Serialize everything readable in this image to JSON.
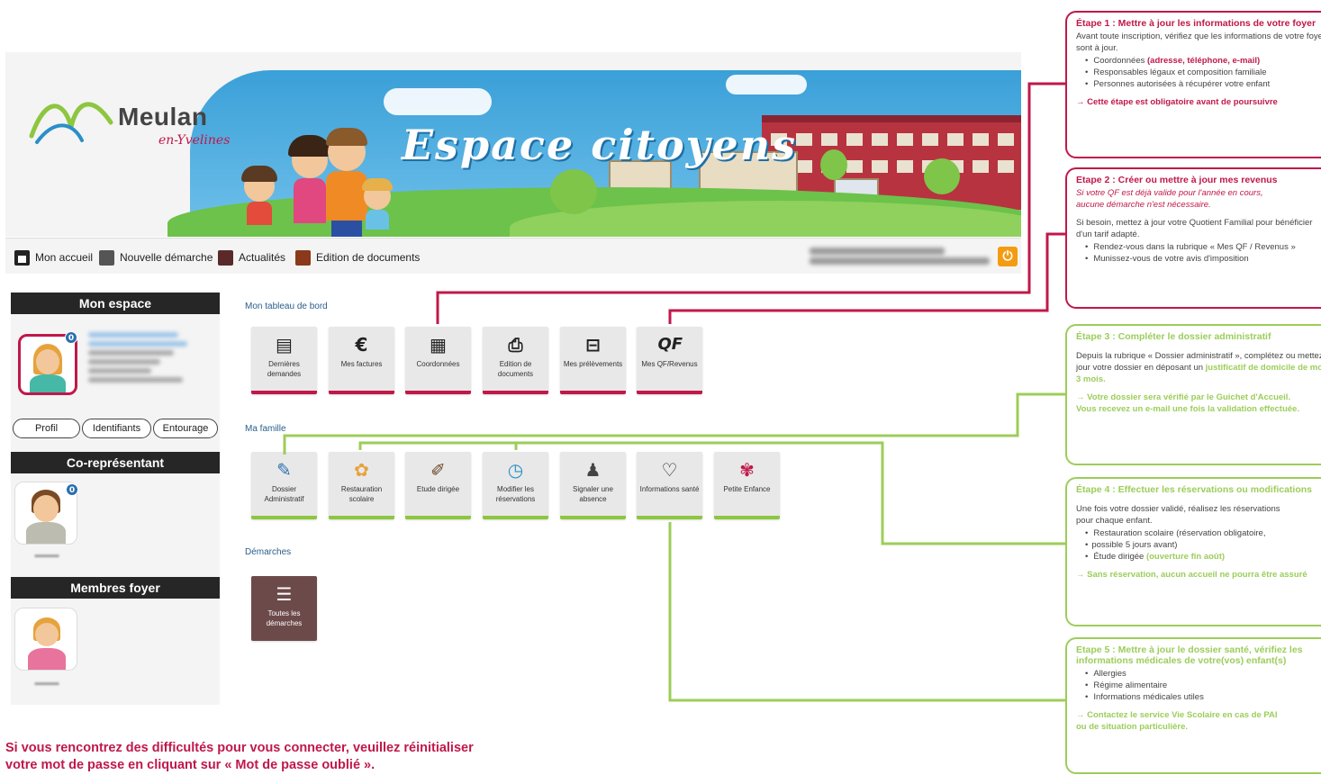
{
  "brand": {
    "name": "Meulan",
    "subtitle": "en-Yvelines",
    "banner_title": "Espace citoyens"
  },
  "nav": {
    "items": [
      {
        "label": "Mon accueil",
        "icon": "home-icon"
      },
      {
        "label": "Nouvelle démarche",
        "icon": "new-request-icon"
      },
      {
        "label": "Actualités",
        "icon": "news-icon"
      },
      {
        "label": "Edition de documents",
        "icon": "print-icon"
      }
    ],
    "logout_icon": "power-icon"
  },
  "sidebar": {
    "mon_espace": "Mon espace",
    "buttons": [
      "Profil",
      "Identifiants",
      "Entourage"
    ],
    "co_representant": "Co-représentant",
    "membres_foyer": "Membres foyer",
    "badge": "0"
  },
  "dashboard": {
    "title": "Mon tableau de bord",
    "tiles": [
      {
        "label": "Dernières demandes",
        "icon": "document-list-icon",
        "glyph": "▤"
      },
      {
        "label": "Mes factures",
        "icon": "euro-icon",
        "glyph": "€"
      },
      {
        "label": "Coordonnées",
        "icon": "contact-card-icon",
        "glyph": "▦"
      },
      {
        "label": "Edition de documents",
        "icon": "printer-icon",
        "glyph": "⎙"
      },
      {
        "label": "Mes prélèvements",
        "icon": "bank-debit-icon",
        "glyph": "⊟"
      },
      {
        "label": "Mes QF/Revenus",
        "icon": "qf-icon",
        "glyph": "QF"
      }
    ]
  },
  "famille": {
    "title": "Ma famille",
    "tiles": [
      {
        "label": "Dossier Administratif",
        "icon": "folder-icon",
        "glyph": "✎"
      },
      {
        "label": "Restauration scolaire",
        "icon": "meal-icon",
        "glyph": "✿"
      },
      {
        "label": "Etude dirigée",
        "icon": "study-icon",
        "glyph": "✐"
      },
      {
        "label": "Modifier les réservations",
        "icon": "clock-icon",
        "glyph": "◷"
      },
      {
        "label": "Signaler une absence",
        "icon": "absence-icon",
        "glyph": "♟"
      },
      {
        "label": "Informations santé",
        "icon": "health-icon",
        "glyph": "♡"
      },
      {
        "label": "Petite Enfance",
        "icon": "pacifier-icon",
        "glyph": "✾"
      }
    ]
  },
  "demarches": {
    "title": "Démarches",
    "tile": {
      "label": "Toutes les démarches",
      "icon": "all-requests-icon",
      "glyph": "☰"
    }
  },
  "callouts": {
    "step1": {
      "title": "Étape 1 : Mettre à jour les informations de votre foyer",
      "intro": [
        "Avant toute inscription, vérifiez que les informations de votre foyer",
        "sont à jour."
      ],
      "items": [
        {
          "text": "Coordonnées ",
          "highlight": "(adresse, téléphone, e-mail)"
        },
        {
          "text": "Responsables légaux et composition familiale",
          "highlight": ""
        },
        {
          "text": "Personnes autorisées à récupérer votre enfant",
          "highlight": ""
        }
      ],
      "note": "→ Cette étape est obligatoire avant de poursuivre"
    },
    "step2": {
      "title": "Etape 2 : Créer ou mettre à jour mes revenus",
      "italic": [
        "Si votre QF est déjà valide pour l'année en cours,",
        "aucune démarche n'est nécessaire."
      ],
      "intro": [
        "Si besoin, mettez à jour votre Quotient Familial pour bénéficier",
        "d'un tarif adapté."
      ],
      "items": [
        "Rendez-vous dans la rubrique « Mes QF / Revenus »",
        "Munissez-vous de votre avis d'imposition"
      ]
    },
    "step3": {
      "title": "Étape 3 : Compléter le dossier administratif",
      "intro": [
        "Depuis la rubrique « Dossier administratif », complétez ou mettez à",
        "jour votre dossier en déposant un "
      ],
      "highlight": [
        "justificatif de domicile de moins de",
        "3 mois."
      ],
      "note": [
        "→ Votre dossier sera vérifié par le Guichet d'Accueil.",
        "Vous recevez un e-mail une fois la validation effectuée."
      ]
    },
    "step4": {
      "title": "Étape 4 : Effectuer les réservations ou modifications",
      "intro": [
        "Une fois votre dossier validé, réalisez les réservations",
        "pour chaque enfant."
      ],
      "items": [
        {
          "text": "Restauration scolaire (réservation obligatoire,",
          "highlight": ""
        },
        {
          "text": "possible 5 jours avant)",
          "highlight": "",
          "cont": true
        },
        {
          "text": "Étude dirigée ",
          "highlight": "(ouverture fin août)"
        }
      ],
      "note": "→ Sans réservation, aucun accueil ne pourra être assuré"
    },
    "step5": {
      "title": [
        "Etape 5 : Mettre à jour le dossier santé, vérifiez les",
        "informations médicales de votre(vos) enfant(s)"
      ],
      "items": [
        "Allergies",
        "Régime alimentaire",
        "Informations médicales utiles"
      ],
      "note": [
        "→ Contactez le service Vie Scolaire en cas de PAI",
        "ou de situation particulière."
      ]
    }
  },
  "help_text": [
    "Si vous rencontrez des difficultés pour vous connecter, veuillez réinitialiser",
    "votre mot de passe en cliquant sur « Mot de passe oublié »."
  ],
  "colors": {
    "pink": "#c0184a",
    "green": "#9ccd5a",
    "dark": "#262626",
    "accent": "#f39c12"
  }
}
